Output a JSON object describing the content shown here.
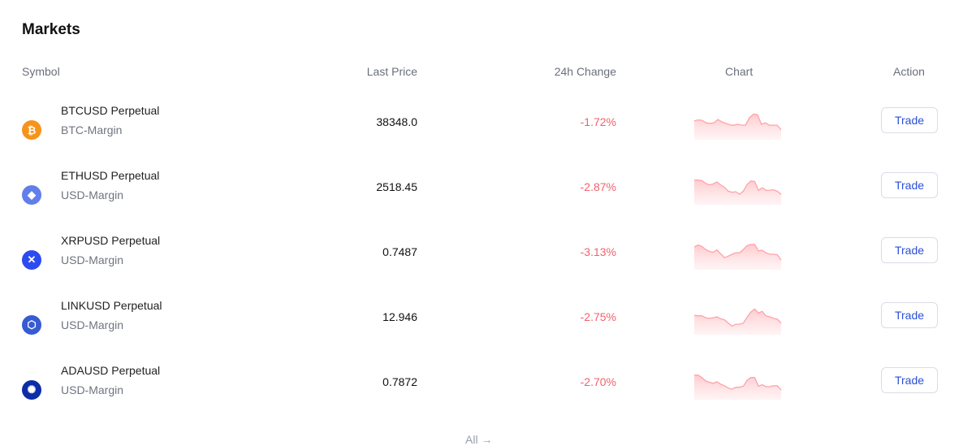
{
  "title": "Markets",
  "headers": {
    "symbol": "Symbol",
    "last_price": "Last Price",
    "change": "24h Change",
    "chart": "Chart",
    "action": "Action"
  },
  "colors": {
    "negative": "#f0616d",
    "trade_text": "#2a4fd6"
  },
  "rows": [
    {
      "name": "BTCUSD Perpetual",
      "margin": "BTC-Margin",
      "price": "38348.0",
      "change": "-1.72%",
      "trade": "Trade",
      "icon": "bitcoin-icon",
      "glyph": "₿",
      "icon_color": "#f7931a",
      "spark": [
        0.55,
        0.6,
        0.58,
        0.45,
        0.42,
        0.45,
        0.62,
        0.5,
        0.42,
        0.35,
        0.32,
        0.38,
        0.33,
        0.33,
        0.72,
        0.9,
        0.87,
        0.38,
        0.45,
        0.33,
        0.33,
        0.33,
        0.1
      ]
    },
    {
      "name": "ETHUSD Perpetual",
      "margin": "USD-Margin",
      "price": "2518.45",
      "change": "-2.87%",
      "trade": "Trade",
      "icon": "ethereum-icon",
      "glyph": "◆",
      "icon_color": "#627eea",
      "spark": [
        0.85,
        0.85,
        0.82,
        0.68,
        0.6,
        0.65,
        0.75,
        0.6,
        0.48,
        0.28,
        0.22,
        0.25,
        0.12,
        0.28,
        0.62,
        0.8,
        0.78,
        0.32,
        0.45,
        0.32,
        0.33,
        0.35,
        0.28,
        0.12
      ]
    },
    {
      "name": "XRPUSD Perpetual",
      "margin": "USD-Margin",
      "price": "0.7487",
      "change": "-3.13%",
      "trade": "Trade",
      "icon": "xrp-icon",
      "glyph": "✕",
      "icon_color": "#2c4bf0",
      "spark": [
        0.75,
        0.85,
        0.78,
        0.62,
        0.52,
        0.48,
        0.6,
        0.4,
        0.2,
        0.28,
        0.38,
        0.45,
        0.45,
        0.62,
        0.82,
        0.88,
        0.88,
        0.55,
        0.58,
        0.45,
        0.38,
        0.38,
        0.35,
        0.08
      ]
    },
    {
      "name": "LINKUSD Perpetual",
      "margin": "USD-Margin",
      "price": "12.946",
      "change": "-2.75%",
      "trade": "Trade",
      "icon": "chainlink-icon",
      "glyph": "⬡",
      "icon_color": "#375bd2",
      "spark": [
        0.58,
        0.55,
        0.56,
        0.45,
        0.42,
        0.45,
        0.5,
        0.4,
        0.35,
        0.18,
        0.02,
        0.12,
        0.12,
        0.18,
        0.48,
        0.75,
        0.9,
        0.7,
        0.78,
        0.55,
        0.5,
        0.42,
        0.38,
        0.18
      ]
    },
    {
      "name": "ADAUSD Perpetual",
      "margin": "USD-Margin",
      "price": "0.7872",
      "change": "-2.70%",
      "trade": "Trade",
      "icon": "cardano-icon",
      "glyph": "✺",
      "icon_color": "#0d2da8",
      "spark": [
        0.85,
        0.85,
        0.72,
        0.55,
        0.48,
        0.42,
        0.5,
        0.38,
        0.3,
        0.18,
        0.12,
        0.22,
        0.22,
        0.28,
        0.58,
        0.72,
        0.72,
        0.28,
        0.35,
        0.25,
        0.25,
        0.3,
        0.3,
        0.08
      ]
    }
  ],
  "footer": {
    "all_label": "All",
    "arrow": "→"
  }
}
